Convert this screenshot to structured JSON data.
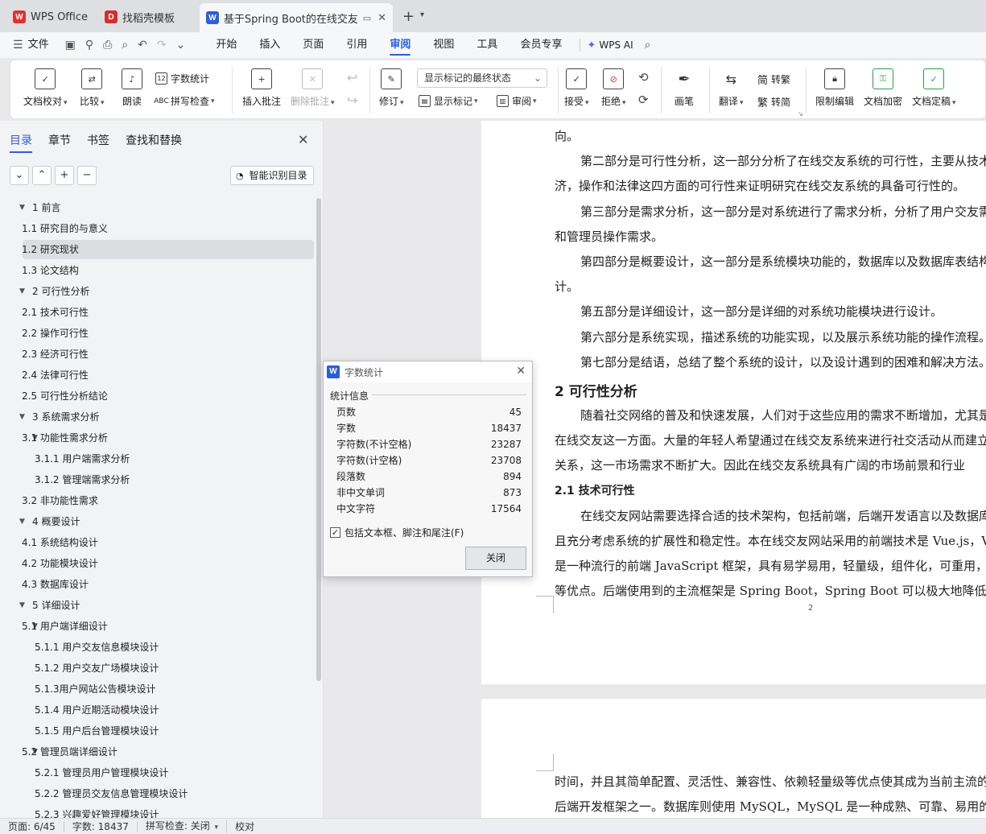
{
  "tabs": [
    {
      "label": "WPS Office",
      "icon": "wps-logo-icon"
    },
    {
      "label": "找稻壳模板",
      "icon": "docer-logo-icon"
    },
    {
      "label": "基于Spring Boot的在线交友系",
      "icon": "writer-logo-icon"
    }
  ],
  "menubar": {
    "file": "文件",
    "items": [
      "开始",
      "插入",
      "页面",
      "引用",
      "审阅",
      "视图",
      "工具",
      "会员专享"
    ],
    "active": "审阅",
    "ai": "WPS AI"
  },
  "ribbon": {
    "doc_check": "文档校对",
    "compare": "比较",
    "read_aloud": "朗读",
    "word_count": "字数统计",
    "spell_check": "拼写检查",
    "insert_comment": "插入批注",
    "delete_comment": "删除批注",
    "track_changes": "修订",
    "markup_state": "显示标记的最终状态",
    "show_markup": "显示标记",
    "review": "审阅",
    "accept": "接受",
    "reject": "拒绝",
    "pen": "画笔",
    "translate": "翻译",
    "to_traditional": "转繁",
    "to_simplified": "转简",
    "restrict_edit": "限制编辑",
    "encrypt": "文档加密",
    "finalize": "文档定稿"
  },
  "sidebar": {
    "tabs": [
      "目录",
      "章节",
      "书签",
      "查找和替换"
    ],
    "smart_toc": "智能识别目录",
    "toc": [
      {
        "label": "1   前言",
        "level": 1,
        "expanded": true
      },
      {
        "label": "1.1   研究目的与意义",
        "level": 2
      },
      {
        "label": "1.2   研究现状",
        "level": 2,
        "selected": true
      },
      {
        "label": "1.3   论文结构",
        "level": 2
      },
      {
        "label": "2   可行性分析",
        "level": 1,
        "expanded": true
      },
      {
        "label": "2.1   技术可行性",
        "level": 2
      },
      {
        "label": "2.2   操作可行性",
        "level": 2
      },
      {
        "label": "2.3   经济可行性",
        "level": 2
      },
      {
        "label": "2.4   法律可行性",
        "level": 2
      },
      {
        "label": "2.5   可行性分析结论",
        "level": 2
      },
      {
        "label": "3   系统需求分析",
        "level": 1,
        "expanded": true
      },
      {
        "label": "3.1   功能性需求分析",
        "level": 2,
        "expanded": true
      },
      {
        "label": "3.1.1   用户端需求分析",
        "level": 3
      },
      {
        "label": "3.1.2   管理端需求分析",
        "level": 3
      },
      {
        "label": "3.2   非功能性需求",
        "level": 2
      },
      {
        "label": "4   概要设计",
        "level": 1,
        "expanded": true
      },
      {
        "label": "4.1   系统结构设计",
        "level": 2
      },
      {
        "label": "4.2   功能模块设计",
        "level": 2
      },
      {
        "label": "4.3   数据库设计",
        "level": 2
      },
      {
        "label": "5   详细设计",
        "level": 1,
        "expanded": true
      },
      {
        "label": "5.1   用户端详细设计",
        "level": 2,
        "expanded": true
      },
      {
        "label": "5.1.1  用户交友信息模块设计",
        "level": 3
      },
      {
        "label": "5.1.2  用户交友广场模块设计",
        "level": 3
      },
      {
        "label": "5.1.3用户网站公告模块设计",
        "level": 3
      },
      {
        "label": "5.1.4  用户近期活动模块设计",
        "level": 3
      },
      {
        "label": "5.1.5  用户后台管理模块设计",
        "level": 3
      },
      {
        "label": "5.2   管理员端详细设计",
        "level": 2,
        "expanded": true
      },
      {
        "label": "5.2.1  管理员用户管理模块设计",
        "level": 3
      },
      {
        "label": "5.2.2  管理员交友信息管理模块设计",
        "level": 3
      },
      {
        "label": "5.2.3  兴趣爱好管理模块设计",
        "level": 3
      }
    ]
  },
  "document": {
    "page1_lines": [
      {
        "type": "p",
        "text": "向。",
        "indent": false
      },
      {
        "type": "p",
        "text": "第二部分是可行性分析，这一部分分析了在线交友系统的可行性，主要从技术，经",
        "indent": true
      },
      {
        "type": "p",
        "text": "济，操作和法律这四方面的可行性来证明研究在线交友系统的具备可行性的。",
        "indent": false
      },
      {
        "type": "p",
        "text": "第三部分是需求分析，这一部分是对系统进行了需求分析，分析了用户交友需求",
        "indent": true
      },
      {
        "type": "p",
        "text": "和管理员操作需求。",
        "indent": false
      },
      {
        "type": "p",
        "text": "第四部分是概要设计，这一部分是系统模块功能的，数据库以及数据库表结构的设",
        "indent": true
      },
      {
        "type": "p",
        "text": "计。",
        "indent": false
      },
      {
        "type": "p",
        "text": "第五部分是详细设计，这一部分是详细的对系统功能模块进行设计。",
        "indent": true
      },
      {
        "type": "p",
        "text": "第六部分是系统实现，描述系统的功能实现，以及展示系统功能的操作流程。",
        "indent": true
      },
      {
        "type": "p",
        "text": "第七部分是结语，总结了整个系统的设计，以及设计遇到的困难和解决方法。",
        "indent": true
      },
      {
        "type": "h2",
        "text": "2    可行性分析"
      },
      {
        "type": "p",
        "text": "随着社交网络的普及和快速发展，人们对于这些应用的需求不断增加，尤其是",
        "indent": true
      },
      {
        "type": "p",
        "text": "在线交友这一方面。大量的年轻人希望通过在线交友系统来进行社交活动从而建立",
        "indent": false
      },
      {
        "type": "p",
        "text": "关系，这一市场需求不断扩大。因此在线交友系统具有广阔的市场前景和行业",
        "indent": false
      },
      {
        "type": "h3",
        "text": "2.1    技术可行性"
      },
      {
        "type": "p",
        "text": "在线交友网站需要选择合适的技术架构，包括前端，后端开发语言以及数据库，并",
        "indent": true
      },
      {
        "type": "p",
        "text": "且充分考虑系统的扩展性和稳定性。本在线交友网站采用的前端技术是 Vue.js，Vue.js",
        "indent": false
      },
      {
        "type": "p",
        "text": "是一种流行的前端 JavaScript 框架，具有易学易用，轻量级，组件化，可重用，",
        "indent": false
      },
      {
        "type": "p",
        "text": "等优点。后端使用到的主流框架是 Spring Boot，Spring Boot 可以极大地降低开发",
        "indent": false
      }
    ],
    "page1_number": "2",
    "page2_lines": [
      {
        "type": "p",
        "text": "时间，并且其简单配置、灵活性、兼容性、依赖轻量级等优点使其成为当前主流的",
        "indent": false
      },
      {
        "type": "p",
        "text": "后端开发框架之一。数据库则使用 MySQL，MySQL 是一种成熟、可靠、易用的",
        "indent": false
      }
    ]
  },
  "dialog": {
    "title": "字数统计",
    "section": "统计信息",
    "stats": [
      {
        "label": "页数",
        "value": "45"
      },
      {
        "label": "字数",
        "value": "18437"
      },
      {
        "label": "字符数(不计空格)",
        "value": "23287"
      },
      {
        "label": "字符数(计空格)",
        "value": "23708"
      },
      {
        "label": "段落数",
        "value": "894"
      },
      {
        "label": "非中文单词",
        "value": "873"
      },
      {
        "label": "中文字符",
        "value": "17564"
      }
    ],
    "include_label": "包括文本框、脚注和尾注(F)",
    "include_checked": true,
    "close_label": "关闭"
  },
  "statusbar": {
    "page": "页面: 6/45",
    "words": "字数: 18437",
    "spell": "拼写检查: 关闭",
    "proof": "校对"
  },
  "colors": {
    "accent": "#2b5fd9",
    "wps_red": "#e0322d",
    "docer_red": "#d62e2e"
  }
}
